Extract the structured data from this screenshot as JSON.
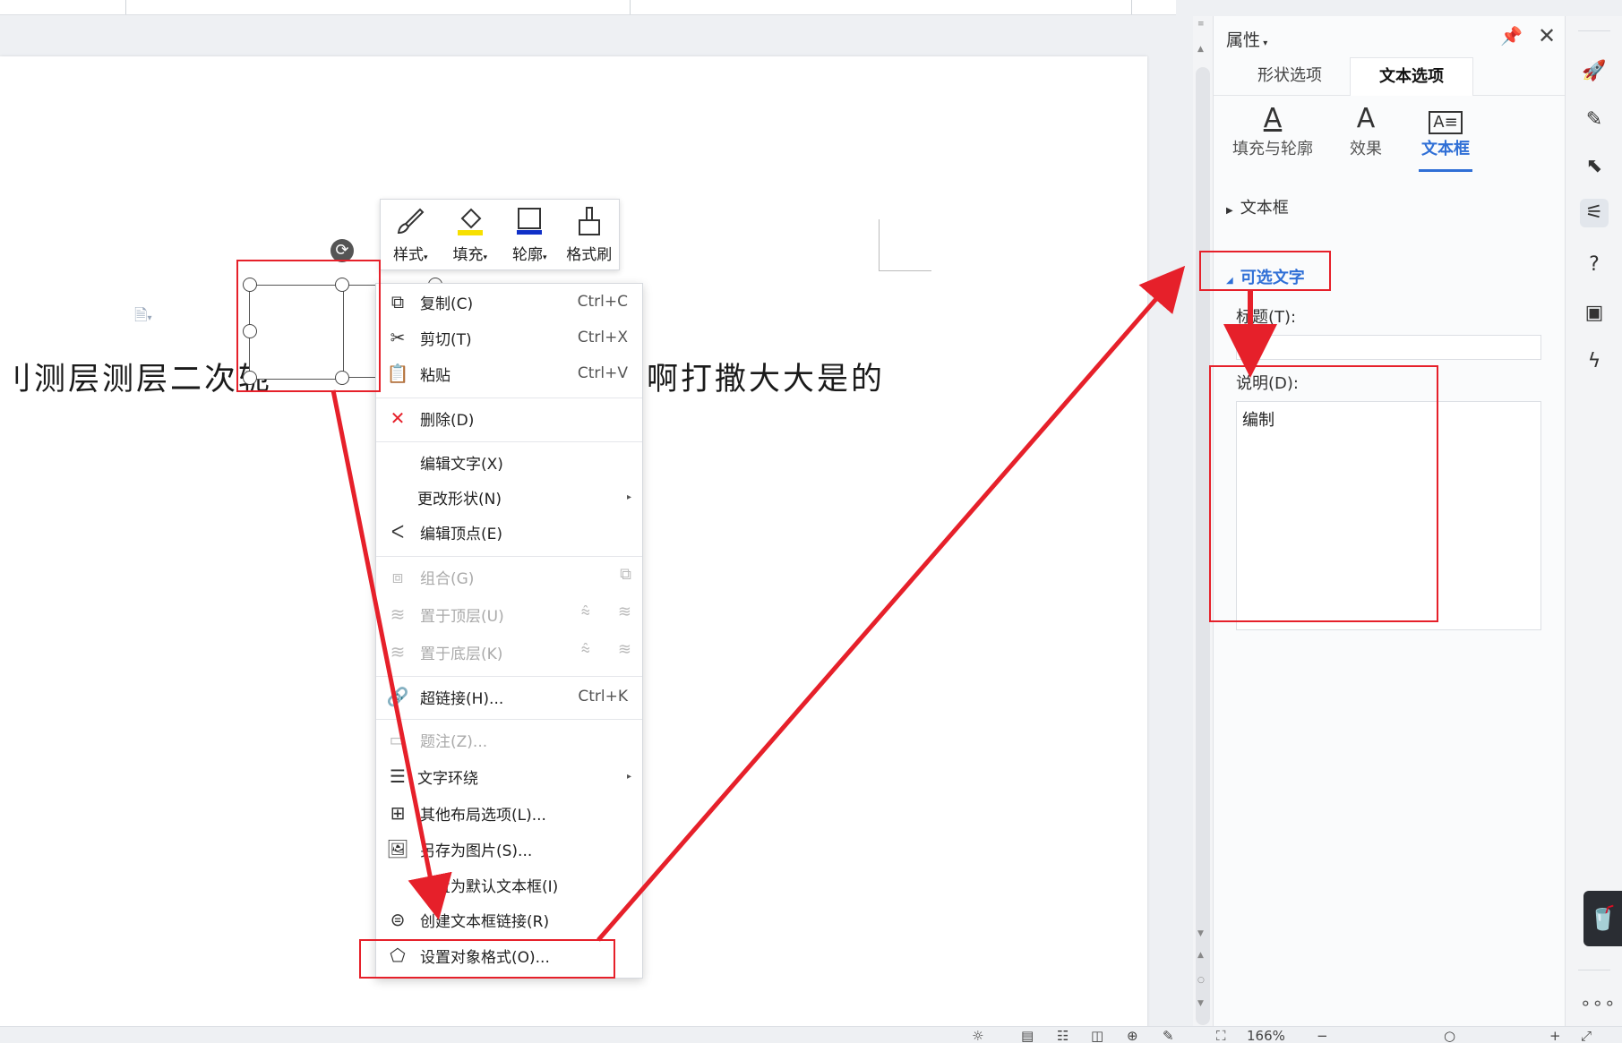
{
  "document": {
    "text_left": "刂测层测层二次轭",
    "text_right": "啊打撒大大是的"
  },
  "mini_toolbar": [
    {
      "label": "样式",
      "icon": "brush-icon",
      "dropdown": true
    },
    {
      "label": "填充",
      "icon": "fill-bucket-icon",
      "dropdown": true
    },
    {
      "label": "轮廓",
      "icon": "outline-icon",
      "dropdown": true
    },
    {
      "label": "格式刷",
      "icon": "format-painter-icon",
      "dropdown": false
    }
  ],
  "context_menu": {
    "copy": {
      "label": "复制(C)",
      "shortcut": "Ctrl+C"
    },
    "cut": {
      "label": "剪切(T)",
      "shortcut": "Ctrl+X"
    },
    "paste": {
      "label": "粘贴",
      "shortcut": "Ctrl+V"
    },
    "delete": {
      "label": "删除(D)"
    },
    "edit_text": {
      "label": "编辑文字(X)"
    },
    "change_shape": {
      "label": "更改形状(N)"
    },
    "edit_points": {
      "label": "编辑顶点(E)"
    },
    "group": {
      "label": "组合(G)"
    },
    "bring_front": {
      "label": "置于顶层(U)"
    },
    "send_back": {
      "label": "置于底层(K)"
    },
    "hyperlink": {
      "label": "超链接(H)...",
      "shortcut": "Ctrl+K"
    },
    "caption": {
      "label": "题注(Z)..."
    },
    "text_wrap": {
      "label": "文字环绕"
    },
    "more_layout": {
      "label": "其他布局选项(L)..."
    },
    "save_as_picture": {
      "label": "另存为图片(S)..."
    },
    "set_default": {
      "label": "设置为默认文本框(I)"
    },
    "create_link": {
      "label": "创建文本框链接(R)"
    },
    "format_object": {
      "label": "设置对象格式(O)..."
    }
  },
  "panel": {
    "title": "属性",
    "tabs": [
      {
        "label": "形状选项",
        "active": false
      },
      {
        "label": "文本选项",
        "active": true
      }
    ],
    "subtabs": [
      {
        "label": "填充与轮廓",
        "icon": "text-fill-icon",
        "active": false
      },
      {
        "label": "效果",
        "icon": "text-effect-icon",
        "active": false
      },
      {
        "label": "文本框",
        "icon": "textbox-icon",
        "active": true
      }
    ],
    "section_textbox": "文本框",
    "section_alt_text": "可选文字",
    "title_label": "标题(T):",
    "title_value": "",
    "desc_label": "说明(D):",
    "desc_value": "编制"
  },
  "statusbar": {
    "zoom": "166%"
  },
  "colors": {
    "accent": "#2f6fd6",
    "annotation": "#e6202a",
    "fill_yellow": "#f7e000",
    "outline_blue": "#1030c8"
  }
}
